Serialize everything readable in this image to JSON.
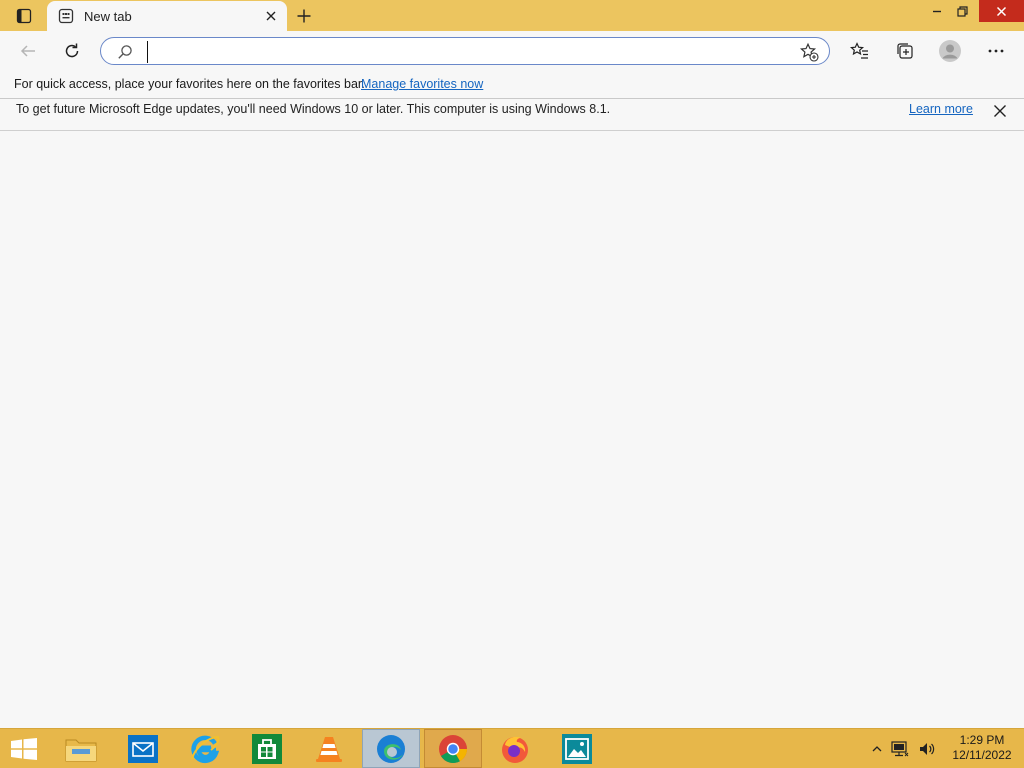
{
  "window": {
    "tab_title": "New tab"
  },
  "toolbar": {
    "address_value": "",
    "address_placeholder": ""
  },
  "favorites_bar": {
    "message": "For quick access, place your favorites here on the favorites bar.",
    "link": "Manage favorites now"
  },
  "infobar": {
    "message": "To get future Microsoft Edge updates, you'll need Windows 10 or later. This computer is using Windows 8.1.",
    "link": "Learn more"
  },
  "taskbar": {
    "apps": [
      "File Explorer",
      "Mail",
      "Internet Explorer",
      "Store",
      "VLC media player",
      "Microsoft Edge",
      "Google Chrome",
      "Firefox",
      "Photos"
    ],
    "active_app": "Microsoft Edge",
    "time": "1:29 PM",
    "date": "12/11/2022"
  },
  "colors": {
    "title_bar": "#ecc55f",
    "taskbar": "#e7b74a",
    "link": "#1565c0",
    "close_button": "#c42b1c",
    "omnibox_border": "#6a88c9"
  }
}
